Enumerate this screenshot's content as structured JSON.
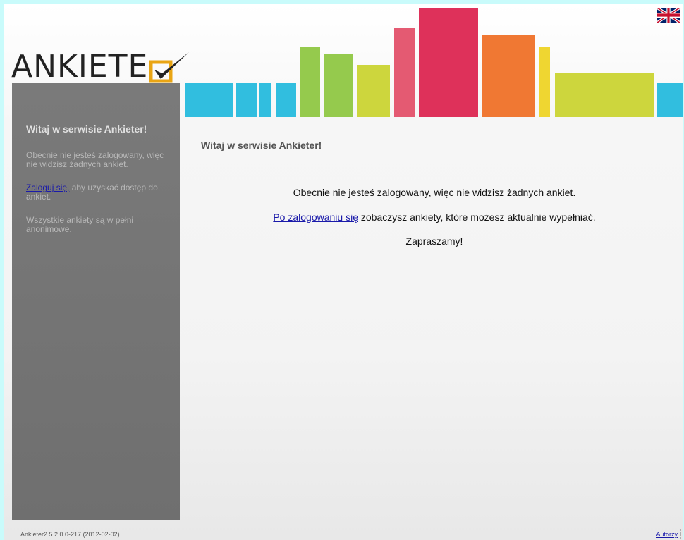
{
  "header": {
    "logo_text": "ANKIETE",
    "language_flag": "uk-flag-icon",
    "bar_colors": {
      "blue": "#1fb8dc",
      "green": "#8cc63e",
      "yellow_green": "#c9d22c",
      "pink": "#e24c66",
      "crimson": "#db1f4c",
      "orange": "#ef6d22",
      "yellow": "#eed320"
    }
  },
  "sidebar": {
    "title": "Witaj w serwisie Ankieter!",
    "not_logged": "Obecnie nie jesteś zalogowany, więc nie widzisz żadnych ankiet.",
    "login_link": "Zaloguj się,",
    "login_rest": " aby uzyskać dostęp do ankiet.",
    "anonymous": "Wszystkie ankiety są w pełni anonimowe."
  },
  "main": {
    "title": "Witaj w serwisie Ankieter!",
    "not_logged": "Obecnie nie jesteś zalogowany, więc nie widzisz żadnych ankiet.",
    "after_login_link": "Po zalogowaniu się",
    "after_login_rest": " zobaczysz ankiety, które możesz aktualnie wypełniać.",
    "invite": "Zapraszamy!"
  },
  "footer": {
    "version": "Ankieter2 5.2.0.0-217 (2012-02-02)",
    "authors": "Autorzy"
  }
}
